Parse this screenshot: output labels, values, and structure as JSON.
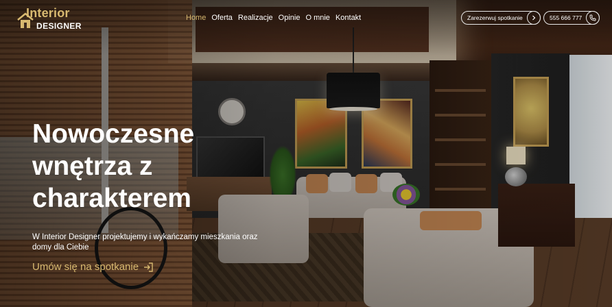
{
  "brand": {
    "top": "Interior",
    "bottom": "DESIGNER",
    "accent_color": "#d8b970",
    "icon": "house-logo-icon"
  },
  "nav": {
    "items": [
      {
        "label": "Home",
        "active": true
      },
      {
        "label": "Oferta",
        "active": false
      },
      {
        "label": "Realizacje",
        "active": false
      },
      {
        "label": "Opinie",
        "active": false
      },
      {
        "label": "O mnie",
        "active": false
      },
      {
        "label": "Kontakt",
        "active": false
      }
    ]
  },
  "header_actions": {
    "booking_label": "Zarezerwuj spotkanie",
    "booking_icon": "chevron-right-icon",
    "phone_label": "555 666 777",
    "phone_icon": "phone-icon"
  },
  "hero": {
    "title_lines": [
      "Nowoczesne",
      "wnętrza z",
      "charakterem"
    ],
    "subtitle_lines": [
      "W Interior Designer projektujemy i wykańczamy mieszkania oraz",
      "domy dla Ciebie"
    ],
    "cta_label": "Umów się na spotkanie",
    "cta_icon": "sign-in-arrow-icon"
  }
}
